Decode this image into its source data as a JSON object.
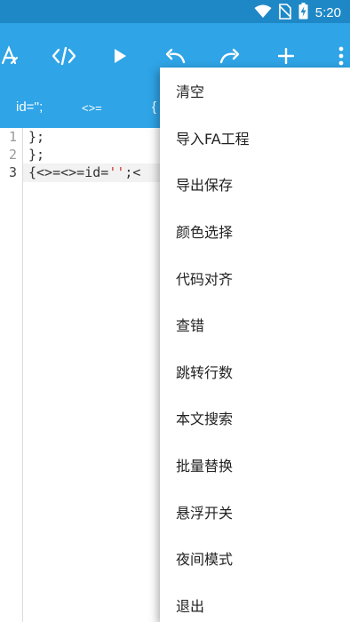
{
  "status_bar": {
    "time": "5:20",
    "icons": [
      "wifi-icon",
      "no-sim-icon",
      "battery-charging-icon"
    ]
  },
  "toolbar": {
    "buttons": [
      "font-style-icon",
      "code-tags-icon",
      "play-icon",
      "undo-icon",
      "redo-icon",
      "plus-icon",
      "more-vert-icon"
    ]
  },
  "snippet_bar": {
    "items": [
      "id='';",
      "<>=",
      "{"
    ]
  },
  "editor": {
    "line_numbers": [
      "1",
      "2",
      "3"
    ],
    "lines": [
      "};",
      "};"
    ],
    "line3": {
      "before": "{<>=<>=id=",
      "string": "''",
      "after": ";<"
    }
  },
  "menu": {
    "items": [
      "清空",
      "导入FA工程",
      "导出保存",
      "颜色选择",
      "代码对齐",
      "查错",
      "跳转行数",
      "本文搜索",
      "批量替换",
      "悬浮开关",
      "夜间模式",
      "退出"
    ]
  },
  "colors": {
    "toolbar": "#2fa4e7",
    "status_bar": "#1e88c7",
    "string": "#d0342c"
  }
}
